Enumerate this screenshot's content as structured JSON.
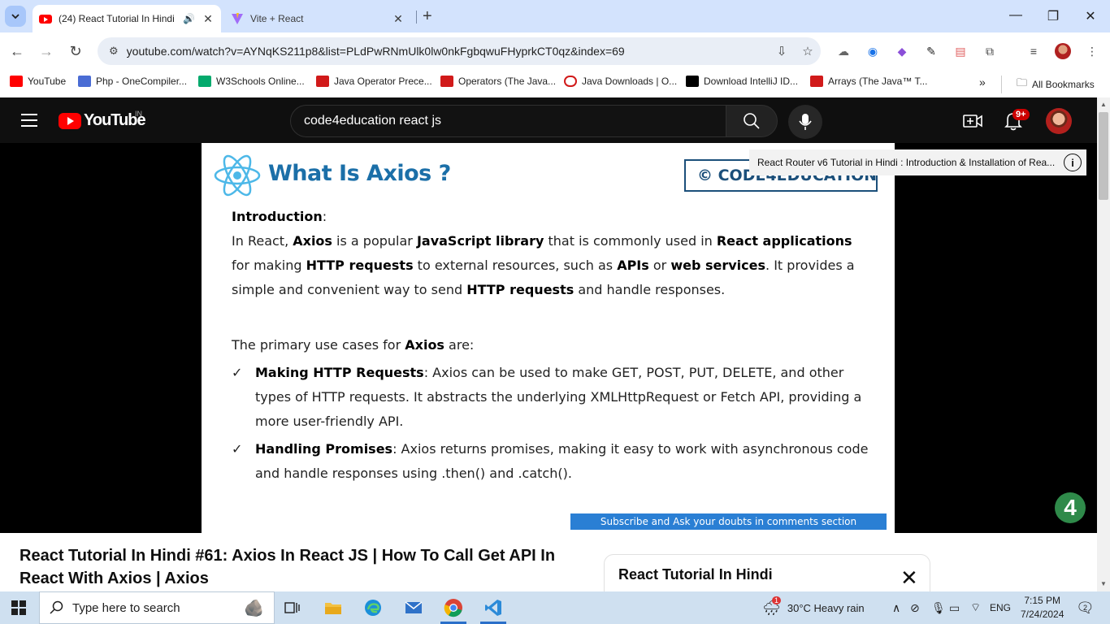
{
  "browser": {
    "tabs": [
      {
        "title": "(24) React Tutorial In Hindi",
        "active": true,
        "audio": true
      },
      {
        "title": "Vite + React",
        "active": false
      }
    ],
    "address": "youtube.com/watch?v=AYNqKS211p8&list=PLdPwRNmUlk0lw0nkFgbqwuFHyprkCT0qz&index=69",
    "bookmarks": [
      {
        "label": "YouTube",
        "color": "#ff0000"
      },
      {
        "label": "Php - OneCompiler...",
        "color": "#4a6cd4"
      },
      {
        "label": "W3Schools Online...",
        "color": "#04aa6d"
      },
      {
        "label": "Java Operator Prece...",
        "color": "#d11a1a"
      },
      {
        "label": "Operators (The Java...",
        "color": "#d11a1a"
      },
      {
        "label": "Java Downloads | O...",
        "color": "#d11a1a"
      },
      {
        "label": "Download IntelliJ ID...",
        "color": "#000000"
      },
      {
        "label": "Arrays (The Java™ T...",
        "color": "#d11a1a"
      }
    ],
    "all_bookmarks": "All Bookmarks"
  },
  "youtube": {
    "logo_text": "YouTube",
    "country": "IN",
    "search_value": "code4education react js",
    "notification_count": "9+"
  },
  "slide": {
    "title": "What Is Axios ?",
    "brand": "© CODE4EDUCATION",
    "intro_heading": "Introduction",
    "paragraph_1": [
      {
        "t": "In React, ",
        "b": false
      },
      {
        "t": "Axios",
        "b": true
      },
      {
        "t": " is a popular ",
        "b": false
      },
      {
        "t": "JavaScript library",
        "b": true
      },
      {
        "t": " that is commonly used in ",
        "b": false
      },
      {
        "t": "React applications",
        "b": true
      },
      {
        "t": " for making ",
        "b": false
      },
      {
        "t": "HTTP requests",
        "b": true
      },
      {
        "t": " to external resources, such as ",
        "b": false
      },
      {
        "t": "APIs",
        "b": true
      },
      {
        "t": " or ",
        "b": false
      },
      {
        "t": "web services",
        "b": true
      },
      {
        "t": ". It provides a simple and convenient way to send ",
        "b": false
      },
      {
        "t": "HTTP requests",
        "b": true
      },
      {
        "t": " and handle responses.",
        "b": false
      }
    ],
    "primary_pre": "The primary use cases for ",
    "primary_bold": "Axios",
    "primary_post": " are:",
    "bullets": [
      {
        "bold": "Making HTTP Requests",
        "text": ": Axios can be used to make GET, POST, PUT, DELETE, and other types of HTTP requests. It abstracts the underlying XMLHttpRequest or Fetch API, providing a more user-friendly API."
      },
      {
        "bold": "Handling Promises",
        "text": ": Axios returns promises, making it easy to work with asynchronous code and handle responses using .then() and .catch()."
      }
    ],
    "footer": "Subscribe and Ask your doubts in comments section"
  },
  "player": {
    "tooltip": "React Router v6 Tutorial in Hindi : Introduction & Installation of Rea..."
  },
  "video": {
    "title": "React Tutorial In Hindi #61: Axios In React JS | How To Call Get API In React With Axios | Axios"
  },
  "playlist": {
    "title": "React Tutorial In Hindi"
  },
  "taskbar": {
    "search_placeholder": "Type here to search",
    "weather": "30°C  Heavy rain",
    "weather_badge": "1",
    "language": "ENG",
    "time": "7:15 PM",
    "date": "7/24/2024",
    "notifications": "2"
  }
}
